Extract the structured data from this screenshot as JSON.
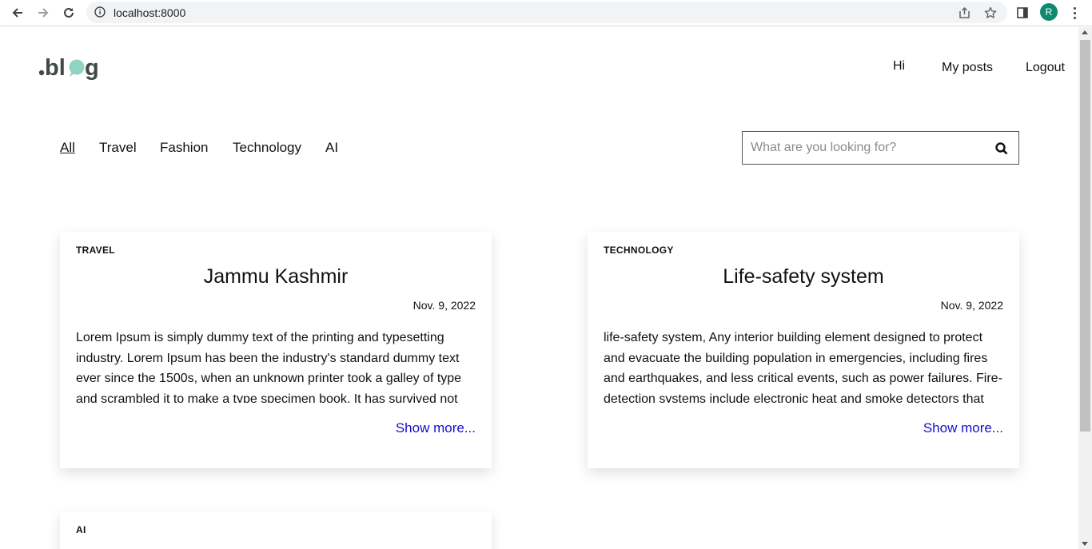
{
  "browser": {
    "url": "localhost:8000",
    "profile_initial": "R"
  },
  "header": {
    "greeting": "Hi",
    "my_posts": "My posts",
    "logout": "Logout"
  },
  "filters": [
    {
      "label": "All",
      "active": true
    },
    {
      "label": "Travel",
      "active": false
    },
    {
      "label": "Fashion",
      "active": false
    },
    {
      "label": "Technology",
      "active": false
    },
    {
      "label": "AI",
      "active": false
    }
  ],
  "search": {
    "placeholder": "What are you looking for?"
  },
  "posts": [
    {
      "category": "TRAVEL",
      "title": "Jammu Kashmir",
      "date": "Nov. 9, 2022",
      "excerpt": "Lorem Ipsum is simply dummy text of the printing and typesetting industry. Lorem Ipsum has been the industry's standard dummy text ever since the 1500s, when an unknown printer took a galley of type and scrambled it to make a type specimen book. It has survived not only five centuries",
      "more": "Show more..."
    },
    {
      "category": "TECHNOLOGY",
      "title": "Life-safety system",
      "date": "Nov. 9, 2022",
      "excerpt": "life-safety system, Any interior building element designed to protect and evacuate the building population in emergencies, including fires and earthquakes, and less critical events, such as power failures. Fire-detection systems include electronic heat and smoke detectors that",
      "more": "Show more..."
    },
    {
      "category": "AI"
    }
  ],
  "colors": {
    "logo_dark": "#3f4a45",
    "logo_accent": "#8fd3c3",
    "link": "#1a0dcc"
  }
}
